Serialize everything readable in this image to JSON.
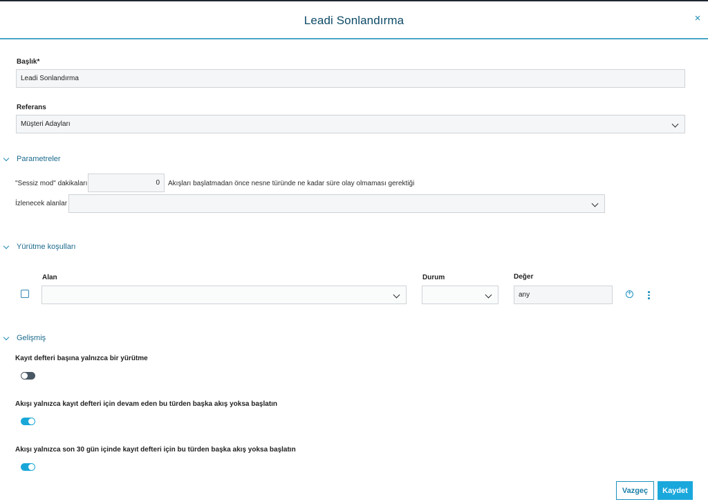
{
  "dialog": {
    "title": "Leadi Sonlandırma",
    "close_symbol": "×"
  },
  "form": {
    "title_label": "Başlık*",
    "title_value": "Leadi Sonlandırma",
    "reference_label": "Referans",
    "reference_value": "Müşteri Adayları"
  },
  "parameters": {
    "section_title": "Parametreler",
    "silent_label": "\"Sessiz mod\" dakikaları",
    "silent_value": "0",
    "silent_hint": "Akışları başlatmadan önce nesne türünde ne kadar süre olay olmaması gerektiği",
    "tracked_label": "İzlenecek alanlar",
    "tracked_value": ""
  },
  "conditions": {
    "section_title": "Yürütme koşulları",
    "headers": {
      "field": "Alan",
      "status": "Durum",
      "value": "Değer"
    },
    "row": {
      "field": "",
      "status": "",
      "value": "any"
    },
    "add_symbol": "+"
  },
  "advanced": {
    "section_title": "Gelişmiş",
    "options": [
      {
        "label": "Kayıt defteri başına yalnızca bir yürütme",
        "enabled": false
      },
      {
        "label": "Akışı yalnızca kayıt defteri için devam eden bu türden başka akış yoksa başlatın",
        "enabled": true
      },
      {
        "label": "Akışı yalnızca son 30 gün içinde kayıt defteri için bu türden başka akış yoksa başlatın",
        "enabled": true
      }
    ]
  },
  "footer": {
    "cancel_label": "Vazgeç",
    "save_label": "Kaydet"
  },
  "colors": {
    "accent": "#1aa8dc",
    "title": "#0d4a66",
    "toggle_off": "#4a5864"
  }
}
